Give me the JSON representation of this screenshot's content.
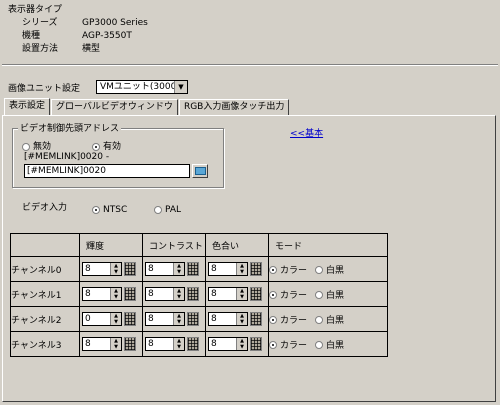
{
  "info": {
    "title": "表示器タイプ",
    "rows": [
      {
        "key": "シリーズ",
        "value": "GP3000 Series"
      },
      {
        "key": "機種",
        "value": "AGP-3550T"
      },
      {
        "key": "設置方法",
        "value": "横型"
      }
    ]
  },
  "unit_setting": {
    "label": "画像ユニット設定",
    "selected": "VMユニット(3000)"
  },
  "tabs": [
    {
      "label": "表示設定",
      "active": true
    },
    {
      "label": "グローバルビデオウィンドウ",
      "active": false
    },
    {
      "label": "RGB入力画像タッチ出力",
      "active": false
    }
  ],
  "video_control": {
    "legend": "ビデオ制御先頭アドレス",
    "options": [
      {
        "label": "無効",
        "selected": false
      },
      {
        "label": "有効",
        "selected": true
      }
    ],
    "address_hint": "[#MEMLINK]0020 -",
    "address_value": "[#MEMLINK]0020"
  },
  "back_link": "<<基本",
  "video_input": {
    "label": "ビデオ入力",
    "options": [
      {
        "label": "NTSC",
        "selected": true
      },
      {
        "label": "PAL",
        "selected": false
      }
    ]
  },
  "table": {
    "headers": [
      "輝度",
      "コントラスト",
      "色合い",
      "モード"
    ],
    "rows": [
      {
        "label": "チャンネル0",
        "brightness": "8",
        "contrast": "8",
        "hue": "8",
        "mode_color": "カラー",
        "mode_bw": "白黒"
      },
      {
        "label": "チャンネル1",
        "brightness": "8",
        "contrast": "8",
        "hue": "8",
        "mode_color": "カラー",
        "mode_bw": "白黒"
      },
      {
        "label": "チャンネル2",
        "brightness": "0",
        "contrast": "8",
        "hue": "8",
        "mode_color": "カラー",
        "mode_bw": "白黒"
      },
      {
        "label": "チャンネル3",
        "brightness": "8",
        "contrast": "8",
        "hue": "8",
        "mode_color": "カラー",
        "mode_bw": "白黒"
      }
    ]
  }
}
